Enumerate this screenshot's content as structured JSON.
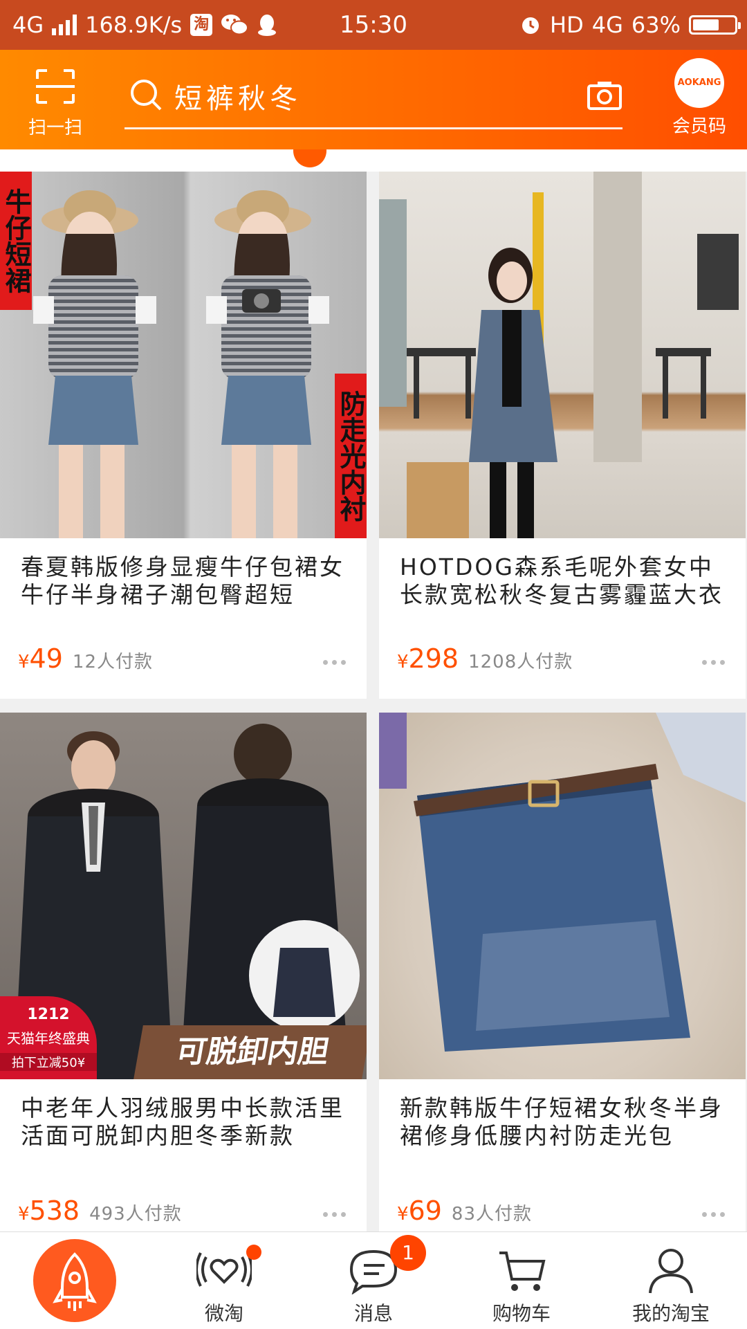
{
  "status_bar": {
    "network": "4G",
    "speed": "168.9K/s",
    "taobao_badge": "淘",
    "time": "15:30",
    "hd": "HD",
    "network_right": "4G",
    "battery": "63%",
    "battery_level": 0.63
  },
  "header": {
    "scan_label": "扫一扫",
    "search_text": "短裤秋冬",
    "member_logo": "AOKANG",
    "member_label": "会员码"
  },
  "colors": {
    "brand_orange": "#ff5000",
    "status_bar": "#c84a1f"
  },
  "products": [
    {
      "title": "春夏韩版修身显瘦牛仔包裙女牛仔半身裙子潮包臀超短",
      "price_symbol": "¥",
      "price": "49",
      "paid": "12人付款",
      "tag_left": "牛仔短裙",
      "tag_right": "防走光内衬"
    },
    {
      "title": "HOTDOG森系毛呢外套女中长款宽松秋冬复古雾霾蓝大衣",
      "price_symbol": "¥",
      "price": "298",
      "paid": "1208人付款"
    },
    {
      "title": "中老年人羽绒服男中长款活里活面可脱卸内胆冬季新款",
      "price_symbol": "¥",
      "price": "538",
      "paid": "493人付款",
      "badge_top": "1212",
      "badge_mid": "天猫年终盛典",
      "badge_bottom": "拍下立减50¥",
      "banner": "可脱卸内胆"
    },
    {
      "title": "新款韩版牛仔短裙女秋冬半身裙修身低腰内衬防走光包",
      "price_symbol": "¥",
      "price": "69",
      "paid": "83人付款"
    }
  ],
  "bottom_nav": {
    "items": [
      {
        "label": "",
        "icon": "rocket-icon"
      },
      {
        "label": "微淘",
        "icon": "heart-signal-icon"
      },
      {
        "label": "消息",
        "icon": "chat-icon",
        "badge": "1"
      },
      {
        "label": "购物车",
        "icon": "cart-icon"
      },
      {
        "label": "我的淘宝",
        "icon": "user-icon"
      }
    ]
  }
}
